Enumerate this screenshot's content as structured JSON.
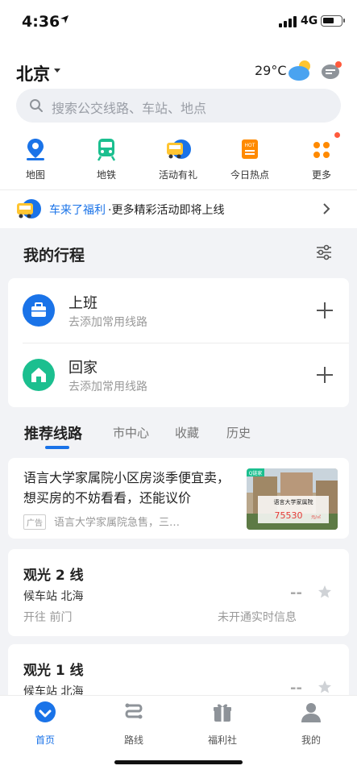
{
  "status_bar": {
    "time": "4:36",
    "network": "4G"
  },
  "header": {
    "city": "北京",
    "temperature": "29°C",
    "search_placeholder": "搜索公交线路、车站、地点"
  },
  "shortcuts": [
    {
      "label": "地图",
      "icon": "map-pin-icon"
    },
    {
      "label": "地铁",
      "icon": "subway-icon"
    },
    {
      "label": "活动有礼",
      "icon": "gift-bus-icon"
    },
    {
      "label": "今日热点",
      "icon": "hot-news-icon"
    },
    {
      "label": "更多",
      "icon": "more-grid-icon"
    }
  ],
  "promo": {
    "highlight": "车来了福利",
    "text": "·更多精彩活动即将上线"
  },
  "my_trips": {
    "title": "我的行程",
    "items": [
      {
        "title": "上班",
        "subtitle": "去添加常用线路",
        "icon": "briefcase-icon",
        "color": "#1a73e8"
      },
      {
        "title": "回家",
        "subtitle": "去添加常用线路",
        "icon": "home-icon",
        "color": "#1bbf8f"
      }
    ]
  },
  "tabs": [
    {
      "label": "推荐线路",
      "active": true
    },
    {
      "label": "市中心",
      "active": false
    },
    {
      "label": "收藏",
      "active": false
    },
    {
      "label": "历史",
      "active": false
    }
  ],
  "ad": {
    "text": "语言大学家属院小区房淡季便宜卖，想买房的不妨看看，还能议价",
    "badge": "广告",
    "subtitle": "语言大学家属院急售，三…",
    "image_caption": "语言大学家属院",
    "image_price": "75530",
    "image_unit": "元/㎡",
    "image_brand": "Q链家"
  },
  "bus_lines": [
    {
      "name": "观光 2 线",
      "stop": "候车站 北海",
      "direction": "开往 前门",
      "eta": "--",
      "status": "未开通实时信息"
    },
    {
      "name": "观光 1 线",
      "stop": "候车站 北海",
      "direction": "",
      "eta": "--",
      "status": ""
    }
  ],
  "bottom_nav": [
    {
      "label": "首页",
      "active": true
    },
    {
      "label": "路线",
      "active": false
    },
    {
      "label": "福利社",
      "active": false
    },
    {
      "label": "我的",
      "active": false
    }
  ],
  "colors": {
    "accent": "#1a73e8",
    "green": "#1bbf8f",
    "hot": "#ff8a00",
    "red_dot": "#ff5a3c"
  }
}
